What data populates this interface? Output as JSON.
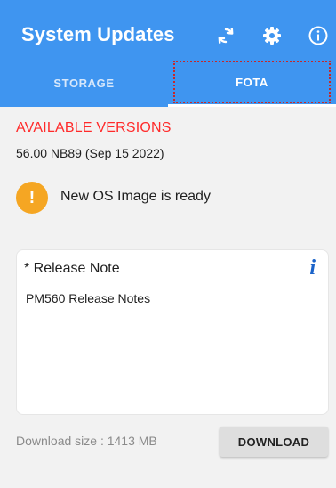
{
  "header": {
    "title": "System Updates",
    "accent_color": "#3f95f0",
    "actions": [
      {
        "icon": "refresh-icon"
      },
      {
        "icon": "gear-icon"
      },
      {
        "icon": "info-icon"
      }
    ]
  },
  "tabs": [
    {
      "label": "STORAGE",
      "selected": false
    },
    {
      "label": "FOTA",
      "selected": true
    }
  ],
  "available": {
    "heading": "AVAILABLE VERSIONS",
    "heading_color": "#ff2a2a",
    "version": "56.00 NB89 (Sep 15 2022)"
  },
  "notice": {
    "icon": "warning-icon",
    "text": "New OS Image is ready"
  },
  "release_note": {
    "title": "* Release Note",
    "info_symbol": "i",
    "body": "PM560 Release Notes"
  },
  "footer": {
    "download_size": "Download size : 1413 MB",
    "download_button": "DOWNLOAD"
  }
}
